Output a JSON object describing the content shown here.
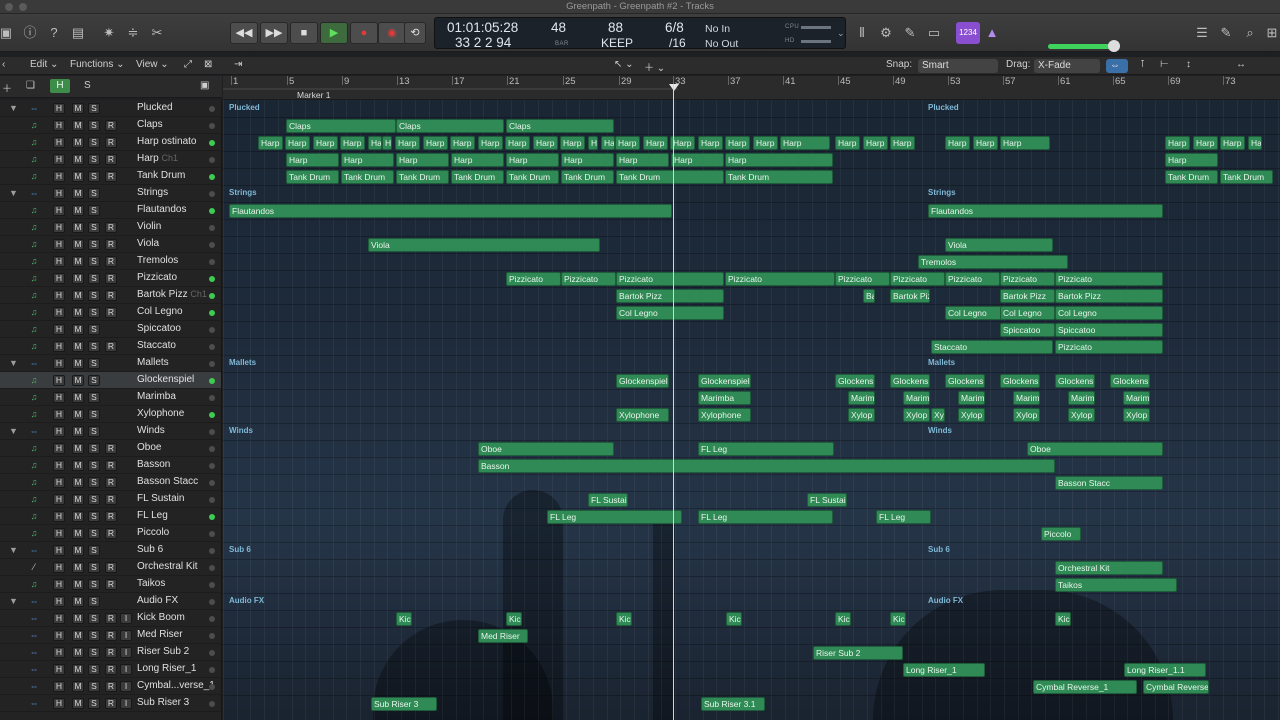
{
  "window": {
    "title": "Greenpath - Greenpath #2 - Tracks"
  },
  "lcd": {
    "time": "01:01:05:28",
    "bars": "33  2  2    94",
    "tempo": "48",
    "tempo_sub": "BAR",
    "tempo2": "88",
    "keep": "KEEP",
    "sig_top": "6/8",
    "sig_bot": "/16",
    "in": "No In",
    "out": "No Out",
    "cpu": "CPU",
    "hd": "HD",
    "key_display": "1234"
  },
  "volume": {
    "level": 0.92
  },
  "ctrl": {
    "edit": "Edit",
    "functions": "Functions",
    "view": "View",
    "snap_label": "Snap:",
    "snap_value": "Smart",
    "drag_label": "Drag:",
    "drag_value": "X-Fade",
    "marker": "Marker 1"
  },
  "hdr": {
    "h": "H",
    "s": "S"
  },
  "ruler": [
    {
      "n": "1"
    },
    {
      "n": "5"
    },
    {
      "n": "9"
    },
    {
      "n": "13"
    },
    {
      "n": "17"
    },
    {
      "n": "21"
    },
    {
      "n": "25"
    },
    {
      "n": "29"
    },
    {
      "n": "33"
    },
    {
      "n": "37"
    },
    {
      "n": "41"
    },
    {
      "n": "45"
    },
    {
      "n": "49"
    },
    {
      "n": "53"
    },
    {
      "n": "57"
    },
    {
      "n": "61"
    },
    {
      "n": "65"
    },
    {
      "n": "69"
    },
    {
      "n": "73"
    }
  ],
  "tracks": [
    {
      "name": "Plucked",
      "type": "folder",
      "r": false,
      "i": false,
      "led": false,
      "chan": ""
    },
    {
      "name": "Claps",
      "type": "midi",
      "r": true,
      "i": false,
      "led": false,
      "chan": ""
    },
    {
      "name": "Harp ostinato",
      "type": "midi",
      "r": true,
      "i": false,
      "led": true,
      "chan": ""
    },
    {
      "name": "Harp",
      "type": "midi",
      "r": true,
      "i": false,
      "led": false,
      "chan": "Ch1"
    },
    {
      "name": "Tank Drum",
      "type": "midi",
      "r": true,
      "i": false,
      "led": true,
      "chan": ""
    },
    {
      "name": "Strings",
      "type": "folder",
      "r": false,
      "i": false,
      "led": false,
      "chan": ""
    },
    {
      "name": "Flautandos",
      "type": "midi",
      "r": false,
      "i": false,
      "led": true,
      "chan": ""
    },
    {
      "name": "Violin",
      "type": "midi",
      "r": true,
      "i": false,
      "led": false,
      "chan": ""
    },
    {
      "name": "Viola",
      "type": "midi",
      "r": true,
      "i": false,
      "led": false,
      "chan": ""
    },
    {
      "name": "Tremolos",
      "type": "midi",
      "r": true,
      "i": false,
      "led": false,
      "chan": ""
    },
    {
      "name": "Pizzicato",
      "type": "midi",
      "r": true,
      "i": false,
      "led": true,
      "chan": ""
    },
    {
      "name": "Bartok Pizz",
      "type": "midi",
      "r": true,
      "i": false,
      "led": true,
      "chan": "Ch1"
    },
    {
      "name": "Col Legno",
      "type": "midi",
      "r": true,
      "i": false,
      "led": true,
      "chan": ""
    },
    {
      "name": "Spiccatoo",
      "type": "midi",
      "r": false,
      "i": false,
      "led": false,
      "chan": ""
    },
    {
      "name": "Staccato",
      "type": "midi",
      "r": true,
      "i": false,
      "led": false,
      "chan": ""
    },
    {
      "name": "Mallets",
      "type": "folder",
      "r": false,
      "i": false,
      "led": false,
      "chan": ""
    },
    {
      "name": "Glockenspiel",
      "type": "midi",
      "r": false,
      "i": false,
      "led": true,
      "chan": ""
    },
    {
      "name": "Marimba",
      "type": "midi",
      "r": false,
      "i": false,
      "led": false,
      "chan": ""
    },
    {
      "name": "Xylophone",
      "type": "midi",
      "r": false,
      "i": false,
      "led": true,
      "chan": ""
    },
    {
      "name": "Winds",
      "type": "folder",
      "r": false,
      "i": false,
      "led": false,
      "chan": ""
    },
    {
      "name": "Oboe",
      "type": "midi",
      "r": true,
      "i": false,
      "led": false,
      "chan": ""
    },
    {
      "name": "Basson",
      "type": "midi",
      "r": true,
      "i": false,
      "led": false,
      "chan": ""
    },
    {
      "name": "Basson Stacc",
      "type": "midi",
      "r": true,
      "i": false,
      "led": false,
      "chan": ""
    },
    {
      "name": "FL Sustain",
      "type": "midi",
      "r": true,
      "i": false,
      "led": false,
      "chan": ""
    },
    {
      "name": "FL Leg",
      "type": "midi",
      "r": true,
      "i": false,
      "led": true,
      "chan": ""
    },
    {
      "name": "Piccolo",
      "type": "midi",
      "r": true,
      "i": false,
      "led": false,
      "chan": ""
    },
    {
      "name": "Sub 6",
      "type": "folder",
      "r": false,
      "i": false,
      "led": false,
      "chan": ""
    },
    {
      "name": "Orchestral Kit",
      "type": "drum",
      "r": true,
      "i": false,
      "led": false,
      "chan": ""
    },
    {
      "name": "Taikos",
      "type": "midi",
      "r": true,
      "i": false,
      "led": false,
      "chan": ""
    },
    {
      "name": "Audio FX",
      "type": "folder",
      "r": false,
      "i": false,
      "led": false,
      "chan": ""
    },
    {
      "name": "Kick Boom",
      "type": "audio",
      "r": true,
      "i": true,
      "led": false,
      "chan": ""
    },
    {
      "name": "Med Riser",
      "type": "audio",
      "r": true,
      "i": true,
      "led": false,
      "chan": ""
    },
    {
      "name": "Riser Sub 2",
      "type": "audio",
      "r": true,
      "i": true,
      "led": false,
      "chan": ""
    },
    {
      "name": "Long Riser_1",
      "type": "audio",
      "r": true,
      "i": true,
      "led": false,
      "chan": ""
    },
    {
      "name": "Cymbal...verse_1",
      "type": "audio",
      "r": true,
      "i": true,
      "led": false,
      "chan": ""
    },
    {
      "name": "Sub Riser 3",
      "type": "audio",
      "r": true,
      "i": true,
      "led": false,
      "chan": ""
    }
  ],
  "folder_labels": {
    "plucked": "Plucked",
    "strings": "Strings",
    "mallets": "Mallets",
    "winds": "Winds",
    "sub6": "Sub 6",
    "audiofx": "Audio FX"
  },
  "regions": [
    {
      "t": "Claps",
      "r": 1
    },
    {
      "t": "Claps",
      "r": 1
    },
    {
      "t": "Claps",
      "r": 1
    },
    {
      "t": "Harp",
      "r": 2
    },
    {
      "t": "Harp",
      "r": 2
    },
    {
      "t": "Harp",
      "r": 2
    },
    {
      "t": "Harp",
      "r": 2
    },
    {
      "t": "Ha",
      "r": 2
    },
    {
      "t": "H",
      "r": 2
    },
    {
      "t": "Harp",
      "r": 2
    },
    {
      "t": "Harp",
      "r": 2
    },
    {
      "t": "Harp",
      "r": 2
    },
    {
      "t": "Harp",
      "r": 2
    },
    {
      "t": "Harp",
      "r": 2
    },
    {
      "t": "Harp",
      "r": 2
    },
    {
      "t": "Harp",
      "r": 2
    },
    {
      "t": "H",
      "r": 2
    },
    {
      "t": "Harp",
      "r": 2
    },
    {
      "t": "Harp",
      "r": 2
    },
    {
      "t": "Harp",
      "r": 2
    },
    {
      "t": "Harp",
      "r": 2
    },
    {
      "t": "Harp",
      "r": 2
    },
    {
      "t": "Harp",
      "r": 2
    },
    {
      "t": "Harp",
      "r": 2
    },
    {
      "t": "Harp",
      "r": 2
    },
    {
      "t": "Harp",
      "r": 2
    },
    {
      "t": "Harp",
      "r": 2
    },
    {
      "t": "Harp",
      "r": 2
    },
    {
      "t": "Harp",
      "r": 2
    },
    {
      "t": "Harp",
      "r": 2
    },
    {
      "t": "Harp",
      "r": 2
    },
    {
      "t": "Harp",
      "r": 2
    },
    {
      "t": "Harp",
      "r": 2
    },
    {
      "t": "Harp",
      "r": 2
    },
    {
      "t": "Ha",
      "r": 2
    },
    {
      "t": "Harp",
      "r": 3
    },
    {
      "t": "Harp",
      "r": 3
    },
    {
      "t": "Harp",
      "r": 3
    },
    {
      "t": "Harp",
      "r": 3
    },
    {
      "t": "Harp",
      "r": 3
    },
    {
      "t": "Harp",
      "r": 3
    },
    {
      "t": "Harp",
      "r": 3
    },
    {
      "t": "Harp",
      "r": 3
    },
    {
      "t": "Harp",
      "r": 3
    },
    {
      "t": "Harp",
      "r": 3
    },
    {
      "t": "Tank Drum",
      "r": 4
    },
    {
      "t": "Tank Drum",
      "r": 4
    },
    {
      "t": "Tank Drum",
      "r": 4
    },
    {
      "t": "Tank Drum",
      "r": 4
    },
    {
      "t": "Tank Drum",
      "r": 4
    },
    {
      "t": "Tank Drum",
      "r": 4
    },
    {
      "t": "Tank Drum",
      "r": 4
    },
    {
      "t": "Tank Drum",
      "r": 4
    },
    {
      "t": "Tank Drum",
      "r": 4
    },
    {
      "t": "Tank Drum",
      "r": 4
    },
    {
      "t": "Flautandos",
      "r": 6
    },
    {
      "t": "Flautandos",
      "r": 6
    },
    {
      "t": "Viola",
      "r": 8
    },
    {
      "t": "Viola",
      "r": 8
    },
    {
      "t": "Tremolos",
      "r": 9
    },
    {
      "t": "Pizzicato",
      "r": 10
    },
    {
      "t": "Pizzicato",
      "r": 10
    },
    {
      "t": "Pizzicato",
      "r": 10
    },
    {
      "t": "Pizzicato",
      "r": 10
    },
    {
      "t": "Pizzicato",
      "r": 10
    },
    {
      "t": "Pizzicato",
      "r": 10
    },
    {
      "t": "Pizzicato",
      "r": 10
    },
    {
      "t": "Pizzicato",
      "r": 10
    },
    {
      "t": "Pizzicato",
      "r": 10
    },
    {
      "t": "Bartok Pizz",
      "r": 11
    },
    {
      "t": "Ba",
      "r": 11
    },
    {
      "t": "Bartok Piz",
      "r": 11
    },
    {
      "t": "Bartok Pizz",
      "r": 11
    },
    {
      "t": "Bartok Pizz",
      "r": 11
    },
    {
      "t": "Col Legno",
      "r": 12
    },
    {
      "t": "Col Legno",
      "r": 12
    },
    {
      "t": "Col Legno",
      "r": 12
    },
    {
      "t": "Col Legno",
      "r": 12
    },
    {
      "t": "Spiccatoo",
      "r": 13
    },
    {
      "t": "Spiccatoo",
      "r": 13
    },
    {
      "t": "Staccato",
      "r": 14
    },
    {
      "t": "Pizzicato",
      "r": 14
    },
    {
      "t": "Glockenspiel",
      "r": 16
    },
    {
      "t": "Glockenspiel",
      "r": 16
    },
    {
      "t": "Glockens",
      "r": 16
    },
    {
      "t": "Glockens",
      "r": 16
    },
    {
      "t": "Glockens",
      "r": 16
    },
    {
      "t": "Glockens",
      "r": 16
    },
    {
      "t": "Glockens",
      "r": 16
    },
    {
      "t": "Glockens",
      "r": 16
    },
    {
      "t": "Marimba",
      "r": 17
    },
    {
      "t": "Marim",
      "r": 17
    },
    {
      "t": "Marim",
      "r": 17
    },
    {
      "t": "Marim",
      "r": 17
    },
    {
      "t": "Marim",
      "r": 17
    },
    {
      "t": "Marim",
      "r": 17
    },
    {
      "t": "Marim",
      "r": 17
    },
    {
      "t": "Xylophone",
      "r": 18
    },
    {
      "t": "Xylophone",
      "r": 18
    },
    {
      "t": "Xylop",
      "r": 18
    },
    {
      "t": "Xylop",
      "r": 18
    },
    {
      "t": "Xy",
      "r": 18
    },
    {
      "t": "Xylop",
      "r": 18
    },
    {
      "t": "Xylop",
      "r": 18
    },
    {
      "t": "Xylop",
      "r": 18
    },
    {
      "t": "Xylop",
      "r": 18
    },
    {
      "t": "Oboe",
      "r": 20
    },
    {
      "t": "FL Leg",
      "r": 20
    },
    {
      "t": "Oboe",
      "r": 20
    },
    {
      "t": "Basson",
      "r": 21
    },
    {
      "t": "Basson Stacc",
      "r": 22
    },
    {
      "t": "FL Sustai",
      "r": 23
    },
    {
      "t": "FL Sustain",
      "r": 23
    },
    {
      "t": "FL Leg",
      "r": 24
    },
    {
      "t": "FL Leg",
      "r": 24
    },
    {
      "t": "FL Leg",
      "r": 24
    },
    {
      "t": "Piccolo",
      "r": 25
    },
    {
      "t": "Orchestral Kit",
      "r": 27
    },
    {
      "t": "Taikos",
      "r": 28
    },
    {
      "t": "Kic",
      "r": 30
    },
    {
      "t": "Kic",
      "r": 30
    },
    {
      "t": "Kic",
      "r": 30
    },
    {
      "t": "Kic",
      "r": 30
    },
    {
      "t": "Kic",
      "r": 30
    },
    {
      "t": "Kic",
      "r": 30
    },
    {
      "t": "Kic",
      "r": 30
    },
    {
      "t": "Med Riser",
      "r": 31
    },
    {
      "t": "Riser Sub 2",
      "r": 32
    },
    {
      "t": "Long Riser_1",
      "r": 33
    },
    {
      "t": "Long Riser_1.1",
      "r": 33
    },
    {
      "t": "Cymbal Reverse_1",
      "r": 34
    },
    {
      "t": "Cymbal Reverse_1",
      "r": 34
    },
    {
      "t": "Sub Riser 3",
      "r": 35
    },
    {
      "t": "Sub Riser 3.1",
      "r": 35
    }
  ]
}
